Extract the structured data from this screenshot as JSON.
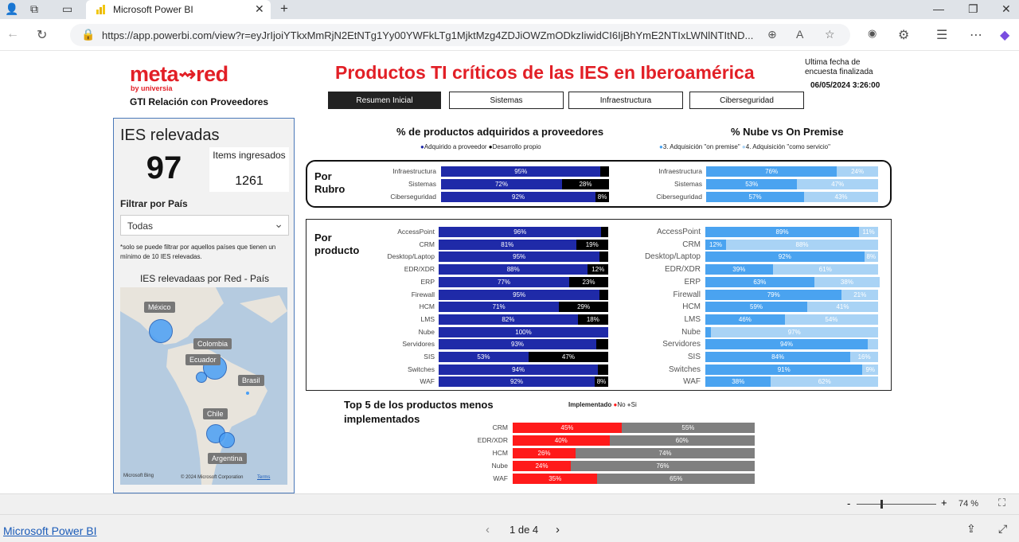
{
  "browser": {
    "tab_title": "Microsoft Power BI",
    "url": "https://app.powerbi.com/view?r=eyJrIjoiYTkxMmRjN2EtNTg1Yy00YWFkLTg1MjktMzg4ZDJiOWZmODkzIiwidCI6IjBhYmE2NTIxLWNlNTItND..."
  },
  "header": {
    "logo_text": "meta⇝red",
    "logo_sub": "by universia",
    "logo_caption": "GTI Relación con Proveedores",
    "title": "Productos TI críticos de las IES en Iberoamérica",
    "update_label": "Ultima fecha de encuesta finalizada",
    "update_date": "06/05/2024 3:26:00"
  },
  "tabs": [
    {
      "label": "Resumen Inicial"
    },
    {
      "label": "Sistemas"
    },
    {
      "label": "Infraestructura"
    },
    {
      "label": "Ciberseguridad"
    }
  ],
  "left_panel": {
    "ies_title": "IES relevadas",
    "ies_value": "97",
    "items_label": "Items ingresados",
    "items_value": "1261",
    "filter_label": "Filtrar por País",
    "filter_value": "Todas",
    "filter_note": "*solo se puede filtrar por aquellos países que tienen un mínimo de 10 IES relevadas.",
    "map_title": "IES relevadaas por Red - País",
    "map_labels": [
      "México",
      "Colombia",
      "Ecuador",
      "Brasil",
      "Chile",
      "Argentina"
    ],
    "map_footer": "© 2024 Microsoft Corporation",
    "map_terms": "Terms",
    "map_brand": "Microsoft Bing"
  },
  "sections": {
    "left_title": "% de productos adquiridos a proveedores",
    "left_legend": [
      "Adquirido a proveedor",
      "Desarrollo propio"
    ],
    "right_title": "% Nube vs On Premise",
    "right_legend": [
      "3. Adquisición \"on premise\"",
      "4. Adquisición \"como servicio\""
    ],
    "por_rubro": "Por Rubro",
    "por_producto": "Por producto",
    "bottom_title": "Top 5 de los productos menos implementados",
    "bottom_legend_title": "Implementado",
    "bottom_legend": [
      "No",
      "Si"
    ]
  },
  "colors": {
    "navy": "#1f2aa8",
    "black": "#000000",
    "blue": "#4aa3f0",
    "lightblue": "#a9d3f5",
    "red": "#ff1a1a",
    "gray": "#7f7f7f",
    "brand_red": "#e21f26"
  },
  "chart_data": [
    {
      "type": "bar",
      "id": "rubro-proveedor",
      "categories": [
        "Infraestructura",
        "Sistemas",
        "Ciberseguridad"
      ],
      "series": [
        {
          "name": "Adquirido a proveedor",
          "values": [
            95,
            72,
            92
          ],
          "labels": [
            "95%",
            "72%",
            "92%"
          ]
        },
        {
          "name": "Desarrollo propio",
          "values": [
            5,
            28,
            8
          ],
          "labels": [
            "",
            "28%",
            "8%"
          ]
        }
      ]
    },
    {
      "type": "bar",
      "id": "rubro-nube",
      "categories": [
        "Infraestructura",
        "Sistemas",
        "Ciberseguridad"
      ],
      "series": [
        {
          "name": "3. Adquisición \"on premise\"",
          "values": [
            76,
            53,
            57
          ],
          "labels": [
            "76%",
            "53%",
            "57%"
          ]
        },
        {
          "name": "4. Adquisición \"como servicio\"",
          "values": [
            24,
            47,
            43
          ],
          "labels": [
            "24%",
            "47%",
            "43%"
          ]
        }
      ]
    },
    {
      "type": "bar",
      "id": "producto-proveedor",
      "categories": [
        "AccessPoint",
        "CRM",
        "Desktop/Laptop",
        "EDR/XDR",
        "ERP",
        "Firewall",
        "HCM",
        "LMS",
        "Nube",
        "Servidores",
        "SIS",
        "Switches",
        "WAF"
      ],
      "series": [
        {
          "name": "Adquirido a proveedor",
          "values": [
            96,
            81,
            95,
            88,
            77,
            95,
            71,
            82,
            100,
            93,
            53,
            94,
            92
          ],
          "labels": [
            "96%",
            "81%",
            "95%",
            "88%",
            "77%",
            "95%",
            "71%",
            "82%",
            "100%",
            "93%",
            "53%",
            "94%",
            "92%"
          ]
        },
        {
          "name": "Desarrollo propio",
          "values": [
            4,
            19,
            5,
            12,
            23,
            5,
            29,
            18,
            0,
            7,
            47,
            6,
            8
          ],
          "labels": [
            "",
            "19%",
            "",
            "12%",
            "23%",
            "",
            "29%",
            "18%",
            "",
            "",
            "47%",
            "",
            "8%"
          ]
        }
      ]
    },
    {
      "type": "bar",
      "id": "producto-nube",
      "categories": [
        "AccessPoint",
        "CRM",
        "Desktop/Laptop",
        "EDR/XDR",
        "ERP",
        "Firewall",
        "HCM",
        "LMS",
        "Nube",
        "Servidores",
        "SIS",
        "Switches",
        "WAF"
      ],
      "series": [
        {
          "name": "3. Adquisición \"on premise\"",
          "values": [
            89,
            12,
            92,
            39,
            63,
            79,
            59,
            46,
            3,
            94,
            84,
            91,
            38
          ],
          "labels": [
            "89%",
            "12%",
            "92%",
            "39%",
            "63%",
            "79%",
            "59%",
            "46%",
            "",
            "94%",
            "84%",
            "91%",
            "38%"
          ]
        },
        {
          "name": "4. Adquisición \"como servicio\"",
          "values": [
            11,
            88,
            8,
            61,
            38,
            21,
            41,
            54,
            97,
            6,
            16,
            9,
            62
          ],
          "labels": [
            "11%",
            "88%",
            "8%",
            "61%",
            "38%",
            "21%",
            "41%",
            "54%",
            "97%",
            "",
            "16%",
            "9%",
            "62%"
          ]
        }
      ]
    },
    {
      "type": "bar",
      "id": "top5",
      "categories": [
        "CRM",
        "EDR/XDR",
        "HCM",
        "Nube",
        "WAF"
      ],
      "series": [
        {
          "name": "No",
          "values": [
            45,
            40,
            26,
            24,
            35
          ],
          "labels": [
            "45%",
            "40%",
            "26%",
            "24%",
            "35%"
          ]
        },
        {
          "name": "Si",
          "values": [
            55,
            60,
            74,
            76,
            65
          ],
          "labels": [
            "55%",
            "60%",
            "74%",
            "76%",
            "65%"
          ]
        }
      ]
    }
  ],
  "footer": {
    "zoom": "74 %",
    "brand": "Microsoft Power BI",
    "page": "1 de 4"
  }
}
